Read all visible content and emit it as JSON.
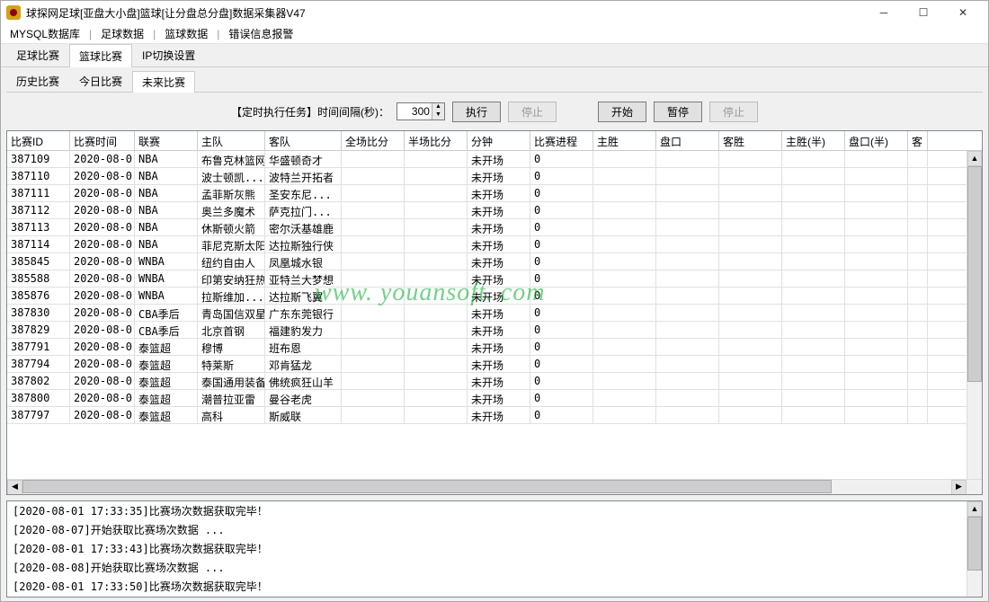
{
  "window": {
    "title": "球探网足球[亚盘大小盘]篮球[让分盘总分盘]数据采集器V47"
  },
  "menubar": [
    "MYSQL数据库",
    "足球数据",
    "篮球数据",
    "错误信息报警"
  ],
  "main_tabs": [
    "足球比赛",
    "篮球比赛",
    "IP切换设置"
  ],
  "main_tab_active": 1,
  "sub_tabs": [
    "历史比赛",
    "今日比赛",
    "未来比赛"
  ],
  "sub_tab_active": 2,
  "controls": {
    "timer_label": "【定时执行任务】时间间隔(秒)：",
    "interval_value": "300",
    "execute": "执行",
    "stop1": "停止",
    "start": "开始",
    "pause": "暂停",
    "stop2": "停止"
  },
  "columns": [
    "比赛ID",
    "比赛时间",
    "联赛",
    "主队",
    "客队",
    "全场比分",
    "半场比分",
    "分钟",
    "比赛进程",
    "主胜",
    "盘口",
    "客胜",
    "主胜(半)",
    "盘口(半)",
    "客"
  ],
  "rows": [
    {
      "id": "387109",
      "time": "2020-08-0...",
      "league": "NBA",
      "home": "布鲁克林篮网",
      "away": "华盛顿奇才",
      "full": "",
      "half": "",
      "min": "未开场",
      "prog": "0"
    },
    {
      "id": "387110",
      "time": "2020-08-0...",
      "league": "NBA",
      "home": "波士顿凯...",
      "away": "波特兰开拓者",
      "full": "",
      "half": "",
      "min": "未开场",
      "prog": "0"
    },
    {
      "id": "387111",
      "time": "2020-08-0...",
      "league": "NBA",
      "home": "孟菲斯灰熊",
      "away": "圣安东尼...",
      "full": "",
      "half": "",
      "min": "未开场",
      "prog": "0"
    },
    {
      "id": "387112",
      "time": "2020-08-0...",
      "league": "NBA",
      "home": "奥兰多魔术",
      "away": "萨克拉门...",
      "full": "",
      "half": "",
      "min": "未开场",
      "prog": "0"
    },
    {
      "id": "387113",
      "time": "2020-08-0...",
      "league": "NBA",
      "home": "休斯顿火箭",
      "away": "密尔沃基雄鹿",
      "full": "",
      "half": "",
      "min": "未开场",
      "prog": "0"
    },
    {
      "id": "387114",
      "time": "2020-08-0...",
      "league": "NBA",
      "home": "菲尼克斯太阳",
      "away": "达拉斯独行侠",
      "full": "",
      "half": "",
      "min": "未开场",
      "prog": "0"
    },
    {
      "id": "385845",
      "time": "2020-08-0...",
      "league": "WNBA",
      "home": "纽约自由人",
      "away": "凤凰城水银",
      "full": "",
      "half": "",
      "min": "未开场",
      "prog": "0"
    },
    {
      "id": "385588",
      "time": "2020-08-0...",
      "league": "WNBA",
      "home": "印第安纳狂热",
      "away": "亚特兰大梦想",
      "full": "",
      "half": "",
      "min": "未开场",
      "prog": "0"
    },
    {
      "id": "385876",
      "time": "2020-08-0...",
      "league": "WNBA",
      "home": "拉斯维加...",
      "away": "达拉斯飞翼",
      "full": "",
      "half": "",
      "min": "未开场",
      "prog": "0"
    },
    {
      "id": "387830",
      "time": "2020-08-0...",
      "league": "CBA季后",
      "home": "青岛国信双星",
      "away": "广东东莞银行",
      "full": "",
      "half": "",
      "min": "未开场",
      "prog": "0"
    },
    {
      "id": "387829",
      "time": "2020-08-0...",
      "league": "CBA季后",
      "home": "北京首钢",
      "away": "福建豹发力",
      "full": "",
      "half": "",
      "min": "未开场",
      "prog": "0"
    },
    {
      "id": "387791",
      "time": "2020-08-0...",
      "league": "泰篮超",
      "home": "穆博",
      "away": "班布恩",
      "full": "",
      "half": "",
      "min": "未开场",
      "prog": "0"
    },
    {
      "id": "387794",
      "time": "2020-08-0...",
      "league": "泰篮超",
      "home": "特莱斯",
      "away": "邓肯猛龙",
      "full": "",
      "half": "",
      "min": "未开场",
      "prog": "0"
    },
    {
      "id": "387802",
      "time": "2020-08-0...",
      "league": "泰篮超",
      "home": "泰国通用装备",
      "away": "佛统疯狂山羊",
      "full": "",
      "half": "",
      "min": "未开场",
      "prog": "0"
    },
    {
      "id": "387800",
      "time": "2020-08-0...",
      "league": "泰篮超",
      "home": "潮普拉亚雷",
      "away": "曼谷老虎",
      "full": "",
      "half": "",
      "min": "未开场",
      "prog": "0"
    },
    {
      "id": "387797",
      "time": "2020-08-0...",
      "league": "泰篮超",
      "home": "高科",
      "away": "斯威联",
      "full": "",
      "half": "",
      "min": "未开场",
      "prog": "0"
    }
  ],
  "log": [
    "[2020-08-01 17:33:35]比赛场次数据获取完毕！",
    "[2020-08-07]开始获取比赛场次数据 ...",
    "[2020-08-01 17:33:43]比赛场次数据获取完毕！",
    "[2020-08-08]开始获取比赛场次数据 ...",
    "[2020-08-01 17:33:50]比赛场次数据获取完毕！"
  ],
  "watermark": "www. youansoft. com"
}
